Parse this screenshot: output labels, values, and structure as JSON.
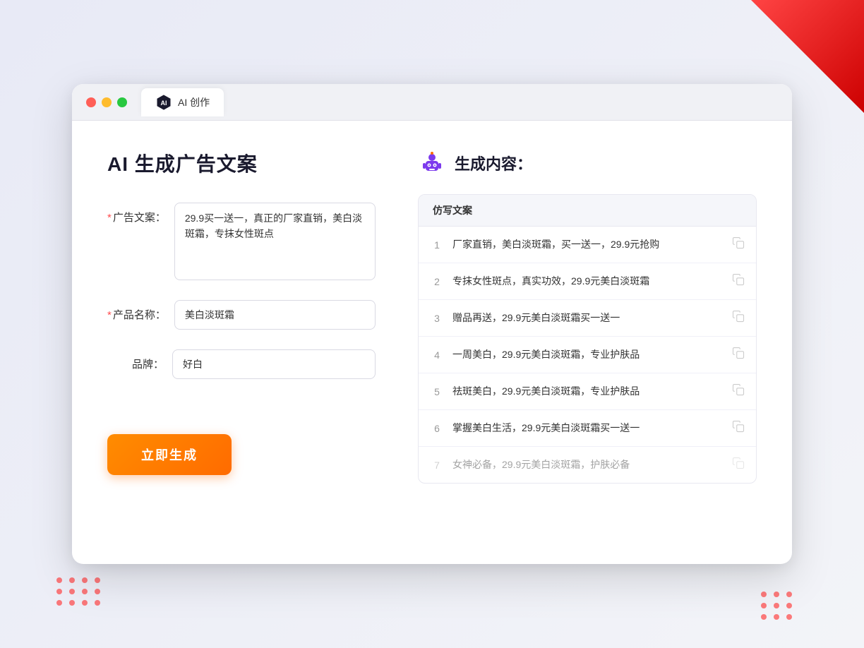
{
  "decorations": {
    "deco_top_right": "triangle",
    "deco_dots": "dots"
  },
  "browser": {
    "traffic_lights": [
      "red",
      "yellow",
      "green"
    ],
    "tab_label": "AI 创作"
  },
  "left_panel": {
    "page_title": "AI 生成广告文案",
    "form": {
      "ad_copy_label": "广告文案：",
      "ad_copy_required": "*",
      "ad_copy_value": "29.9买一送一，真正的厂家直销，美白淡斑霜，专抹女性斑点",
      "product_name_label": "产品名称：",
      "product_name_required": "*",
      "product_name_value": "美白淡斑霜",
      "brand_label": "品牌：",
      "brand_value": "好白"
    },
    "generate_button": "立即生成"
  },
  "right_panel": {
    "title": "生成内容：",
    "table_header": "仿写文案",
    "results": [
      {
        "num": "1",
        "text": "厂家直销，美白淡斑霜，买一送一，29.9元抢购"
      },
      {
        "num": "2",
        "text": "专抹女性斑点，真实功效，29.9元美白淡斑霜"
      },
      {
        "num": "3",
        "text": "赠品再送，29.9元美白淡斑霜买一送一"
      },
      {
        "num": "4",
        "text": "一周美白，29.9元美白淡斑霜，专业护肤品"
      },
      {
        "num": "5",
        "text": "祛斑美白，29.9元美白淡斑霜，专业护肤品"
      },
      {
        "num": "6",
        "text": "掌握美白生活，29.9元美白淡斑霜买一送一"
      },
      {
        "num": "7",
        "text": "女神必备，29.9元美白淡斑霜，护肤必备",
        "faded": true
      }
    ]
  }
}
